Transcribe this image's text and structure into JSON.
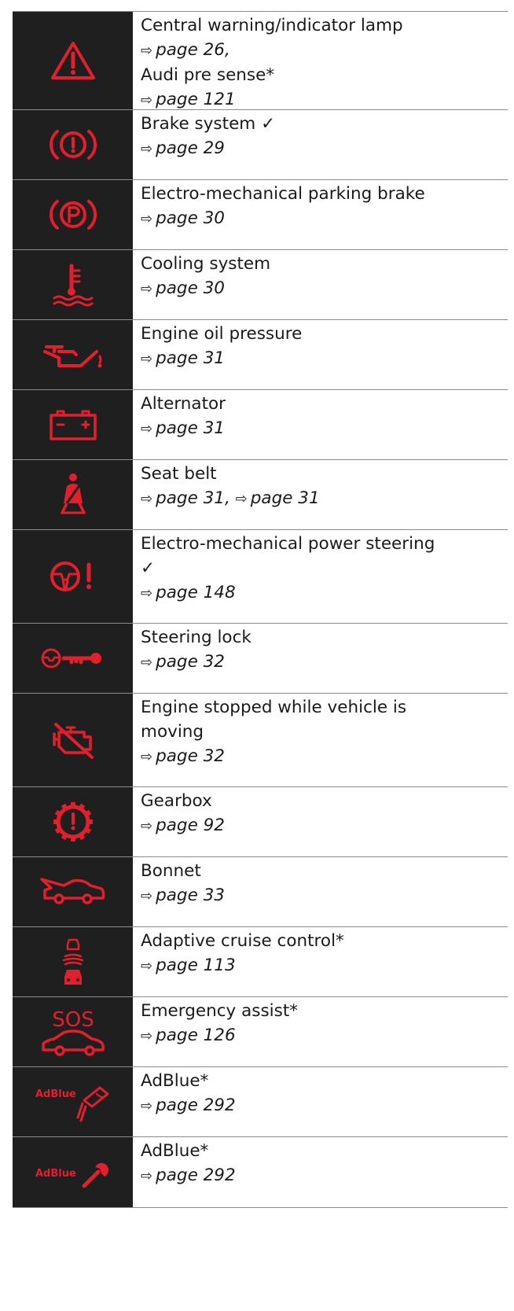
{
  "colors": {
    "icon_red": "#e31e2d",
    "icon_bg": "#1f1f1f",
    "text": "#1a1a1a",
    "rule": "#8c8c8c"
  },
  "rows": [
    {
      "icon": "warning-triangle-icon",
      "lines": [
        {
          "kind": "text",
          "text": "Central warning/indicator lamp"
        },
        {
          "kind": "ref",
          "arrow": "⇨",
          "ref": "page 26,",
          "extra": ""
        },
        {
          "kind": "text",
          "text": "Audi pre sense*"
        },
        {
          "kind": "ref",
          "arrow": "⇨",
          "ref": "page 121",
          "extra": ""
        }
      ]
    },
    {
      "icon": "brake-system-icon",
      "lines": [
        {
          "kind": "text",
          "text": "Brake system ✓"
        },
        {
          "kind": "ref",
          "arrow": "⇨",
          "ref": "page 29",
          "extra": ""
        }
      ]
    },
    {
      "icon": "parking-brake-icon",
      "lines": [
        {
          "kind": "text",
          "text": "Electro-mechanical parking brake"
        },
        {
          "kind": "ref",
          "arrow": "⇨",
          "ref": "page 30",
          "extra": ""
        }
      ]
    },
    {
      "icon": "coolant-temperature-icon",
      "lines": [
        {
          "kind": "text",
          "text": "Cooling system"
        },
        {
          "kind": "ref",
          "arrow": "⇨",
          "ref": "page 30",
          "extra": ""
        }
      ]
    },
    {
      "icon": "oil-can-icon",
      "lines": [
        {
          "kind": "text",
          "text": "Engine oil pressure"
        },
        {
          "kind": "ref",
          "arrow": "⇨",
          "ref": "page 31",
          "extra": ""
        }
      ]
    },
    {
      "icon": "battery-icon",
      "lines": [
        {
          "kind": "text",
          "text": "Alternator"
        },
        {
          "kind": "ref",
          "arrow": "⇨",
          "ref": "page 31",
          "extra": ""
        }
      ]
    },
    {
      "icon": "seat-belt-icon",
      "lines": [
        {
          "kind": "text",
          "text": "Seat belt"
        },
        {
          "kind": "ref",
          "arrow": "⇨",
          "ref": "page 31, ",
          "extra": "⇨",
          "ref2": "page 31"
        }
      ]
    },
    {
      "icon": "power-steering-icon",
      "lines": [
        {
          "kind": "text",
          "text": "Electro-mechanical power steering"
        },
        {
          "kind": "text",
          "text": "✓"
        },
        {
          "kind": "ref",
          "arrow": "⇨",
          "ref": "page 148",
          "extra": ""
        }
      ]
    },
    {
      "icon": "steering-lock-icon",
      "lines": [
        {
          "kind": "text",
          "text": "Steering lock"
        },
        {
          "kind": "ref",
          "arrow": "⇨",
          "ref": "page 32",
          "extra": ""
        }
      ]
    },
    {
      "icon": "engine-stopped-icon",
      "lines": [
        {
          "kind": "text",
          "text": "Engine stopped while vehicle is"
        },
        {
          "kind": "text",
          "text": "moving"
        },
        {
          "kind": "ref",
          "arrow": "⇨",
          "ref": "page 32",
          "extra": ""
        }
      ]
    },
    {
      "icon": "gearbox-icon",
      "lines": [
        {
          "kind": "text",
          "text": "Gearbox"
        },
        {
          "kind": "ref",
          "arrow": "⇨",
          "ref": "page 92",
          "extra": ""
        }
      ]
    },
    {
      "icon": "bonnet-icon",
      "lines": [
        {
          "kind": "text",
          "text": "Bonnet"
        },
        {
          "kind": "ref",
          "arrow": "⇨",
          "ref": "page 33",
          "extra": ""
        }
      ]
    },
    {
      "icon": "adaptive-cruise-icon",
      "lines": [
        {
          "kind": "text",
          "text": "Adaptive cruise control*"
        },
        {
          "kind": "ref",
          "arrow": "⇨",
          "ref": "page 113",
          "extra": ""
        }
      ]
    },
    {
      "icon": "sos-icon",
      "icon_text": "SOS",
      "lines": [
        {
          "kind": "text",
          "text": "Emergency assist*"
        },
        {
          "kind": "ref",
          "arrow": "⇨",
          "ref": "page 126",
          "extra": ""
        }
      ]
    },
    {
      "icon": "adblue-refill-icon",
      "icon_text": "AdBlue",
      "lines": [
        {
          "kind": "text",
          "text": "AdBlue*"
        },
        {
          "kind": "ref",
          "arrow": "⇨",
          "ref": "page 292",
          "extra": ""
        }
      ]
    },
    {
      "icon": "adblue-wrench-icon",
      "icon_text": "AdBlue",
      "lines": [
        {
          "kind": "text",
          "text": "AdBlue*"
        },
        {
          "kind": "ref",
          "arrow": "⇨",
          "ref": "page 292",
          "extra": ""
        }
      ]
    }
  ]
}
